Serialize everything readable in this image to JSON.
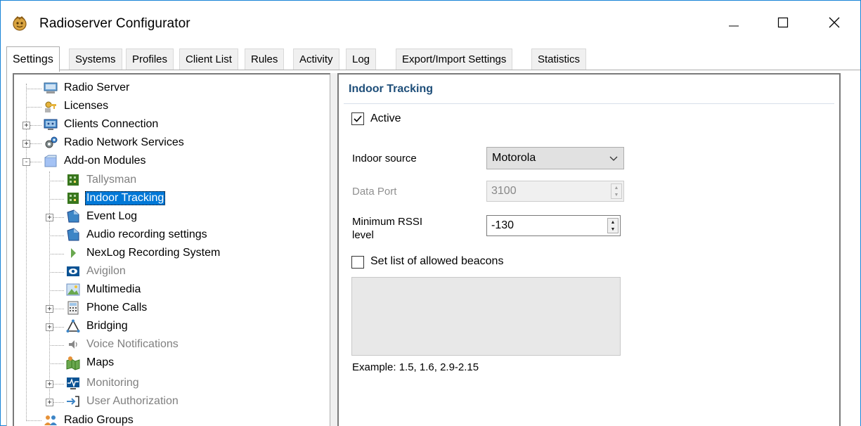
{
  "window": {
    "title": "Radioserver Configurator",
    "accent": "#1883d7"
  },
  "tabs": [
    {
      "label": "Settings",
      "active": true
    },
    {
      "label": "Systems"
    },
    {
      "label": "Profiles"
    },
    {
      "label": "Client List"
    },
    {
      "label": "Rules"
    },
    {
      "label": "Activity"
    },
    {
      "label": "Log"
    },
    {
      "label": "Export/Import Settings"
    },
    {
      "label": "Statistics"
    }
  ],
  "tree": {
    "items": [
      {
        "label": "Radio Server",
        "icon": "radio-server-icon"
      },
      {
        "label": "Licenses",
        "icon": "licenses-icon"
      },
      {
        "label": "Clients Connection",
        "icon": "clients-connection-icon",
        "expander": "+"
      },
      {
        "label": "Radio Network Services",
        "icon": "radio-network-services-icon",
        "expander": "+"
      },
      {
        "label": "Add-on Modules",
        "icon": "add-on-modules-icon",
        "expander": "-"
      },
      {
        "label": "Tallysman",
        "icon": "tallysman-icon",
        "disabled": true
      },
      {
        "label": "Indoor Tracking",
        "icon": "indoor-tracking-icon",
        "selected": true
      },
      {
        "label": "Event Log",
        "icon": "event-log-icon",
        "expander": "+"
      },
      {
        "label": "Audio recording settings",
        "icon": "audio-recording-icon"
      },
      {
        "label": "NexLog Recording System",
        "icon": "nexlog-icon"
      },
      {
        "label": "Avigilon",
        "icon": "avigilon-icon",
        "disabled": true
      },
      {
        "label": "Multimedia",
        "icon": "multimedia-icon"
      },
      {
        "label": "Phone Calls",
        "icon": "phone-calls-icon",
        "expander": "+"
      },
      {
        "label": "Bridging",
        "icon": "bridging-icon",
        "expander": "+"
      },
      {
        "label": "Voice Notifications",
        "icon": "voice-notifications-icon",
        "disabled": true
      },
      {
        "label": "Maps",
        "icon": "maps-icon"
      },
      {
        "label": "Monitoring",
        "icon": "monitoring-icon",
        "disabled": true,
        "expander": "+"
      },
      {
        "label": "User Authorization",
        "icon": "user-authorization-icon",
        "disabled": true,
        "expander": "+"
      },
      {
        "label": "Radio Groups",
        "icon": "radio-groups-icon"
      }
    ]
  },
  "panel": {
    "title": "Indoor Tracking",
    "active_label": "Active",
    "active_checked": true,
    "indoor_source_label": "Indoor source",
    "indoor_source_value": "Motorola",
    "data_port_label": "Data Port",
    "data_port_value": "3100",
    "min_rssi_label_line1": "Minimum RSSI",
    "min_rssi_label_line2": "level",
    "min_rssi_value": "-130",
    "beacons_label": "Set list of allowed beacons",
    "beacons_checked": false,
    "beacons_value": "",
    "example_text": "Example: 1.5, 1.6, 2.9-2.15"
  }
}
